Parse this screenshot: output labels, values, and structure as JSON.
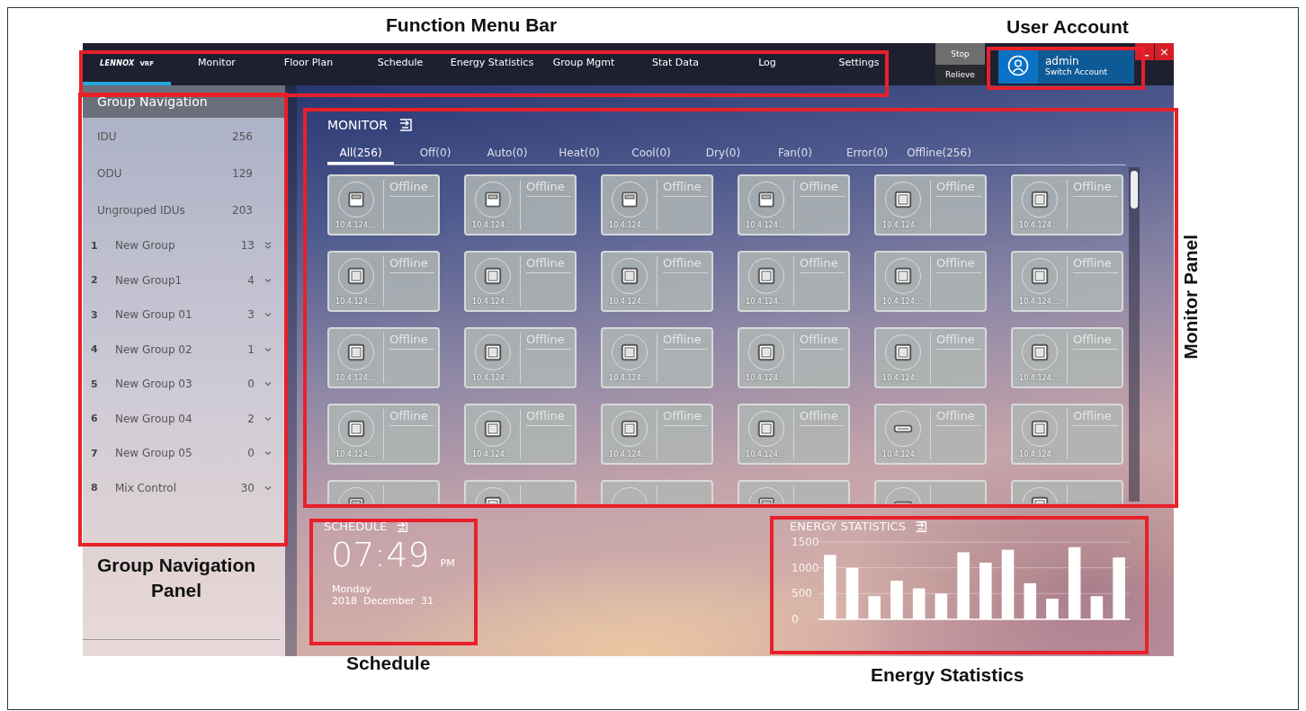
{
  "annotations": {
    "menu_bar": "Function Menu Bar",
    "user_account": "User Account",
    "monitor_panel": "Monitor Panel",
    "group_navigation": "Group Navigation Panel",
    "schedule": "Schedule",
    "energy_statistics": "Energy Statistics"
  },
  "top_bar": {
    "logo": {
      "brand": "LENNOX",
      "suffix": "VRF",
      "selected": true
    },
    "menu": [
      {
        "label": "Monitor",
        "selected": false
      },
      {
        "label": "Floor Plan",
        "selected": false
      },
      {
        "label": "Schedule",
        "selected": false
      },
      {
        "label": "Energy Statistics",
        "selected": false
      },
      {
        "label": "Group Mgmt",
        "selected": false
      },
      {
        "label": "Stat Data",
        "selected": false
      },
      {
        "label": "Log",
        "selected": false
      },
      {
        "label": "Settings",
        "selected": false
      }
    ],
    "actions": [
      {
        "label": "Stop",
        "selected": true
      },
      {
        "label": "Relieve",
        "selected": false
      }
    ],
    "account": {
      "name": "admin",
      "action": "Switch Account"
    },
    "window_controls": {
      "close": "×"
    }
  },
  "sidebar": {
    "title": "Group Navigation",
    "summary": [
      {
        "label": "IDU",
        "count": "256"
      },
      {
        "label": "ODU",
        "count": "129"
      },
      {
        "label": "Ungrouped IDUs",
        "count": "203"
      }
    ],
    "groups": [
      {
        "index": "1",
        "name": "New Group",
        "count": "13",
        "kind": "double"
      },
      {
        "index": "2",
        "name": "New Group1",
        "count": "4",
        "kind": "single"
      },
      {
        "index": "3",
        "name": "New Group 01",
        "count": "3",
        "kind": "single"
      },
      {
        "index": "4",
        "name": "New Group 02",
        "count": "1",
        "kind": "single"
      },
      {
        "index": "5",
        "name": "New Group 03",
        "count": "0",
        "kind": "single"
      },
      {
        "index": "6",
        "name": "New Group 04",
        "count": "2",
        "kind": "single"
      },
      {
        "index": "7",
        "name": "New Group 05",
        "count": "0",
        "kind": "single"
      },
      {
        "index": "8",
        "name": "Mix Control",
        "count": "30",
        "kind": "single"
      }
    ]
  },
  "monitor": {
    "title": "MONITOR",
    "tabs": [
      {
        "label": "All(256)",
        "selected": true
      },
      {
        "label": "Off(0)",
        "selected": false
      },
      {
        "label": "Auto(0)",
        "selected": false
      },
      {
        "label": "Heat(0)",
        "selected": false
      },
      {
        "label": "Cool(0)",
        "selected": false
      },
      {
        "label": "Dry(0)",
        "selected": false
      },
      {
        "label": "Fan(0)",
        "selected": false
      },
      {
        "label": "Error(0)",
        "selected": false
      },
      {
        "label": "Offline(256)",
        "selected": false
      }
    ],
    "devices": [
      {
        "kind": "panel",
        "status": "Offline",
        "ip": "10.4.124...."
      },
      {
        "kind": "panel",
        "status": "Offline",
        "ip": "10.4.124...."
      },
      {
        "kind": "panel",
        "status": "Offline",
        "ip": "10.4.124...."
      },
      {
        "kind": "panel",
        "status": "Offline",
        "ip": "10.4.124...."
      },
      {
        "kind": "cassette",
        "status": "Offline",
        "ip": "10.4.124...."
      },
      {
        "kind": "cassette",
        "status": "Offline",
        "ip": "10.4.124...."
      },
      {
        "kind": "cassette",
        "status": "Offline",
        "ip": "10.4.124...."
      },
      {
        "kind": "cassette",
        "status": "Offline",
        "ip": "10.4.124...."
      },
      {
        "kind": "cassette",
        "status": "Offline",
        "ip": "10.4.124...."
      },
      {
        "kind": "cassette",
        "status": "Offline",
        "ip": "10.4.124...."
      },
      {
        "kind": "cassette",
        "status": "Offline",
        "ip": "10.4.124...."
      },
      {
        "kind": "cassette",
        "status": "Offline",
        "ip": "10.4.124...."
      },
      {
        "kind": "cassette",
        "status": "Offline",
        "ip": "10.4.124...."
      },
      {
        "kind": "cassette",
        "status": "Offline",
        "ip": "10.4.124...."
      },
      {
        "kind": "cassette",
        "status": "Offline",
        "ip": "10.4.124...."
      },
      {
        "kind": "cassette",
        "status": "Offline",
        "ip": "10.4.124...."
      },
      {
        "kind": "cassette",
        "status": "Offline",
        "ip": "10.4.124...."
      },
      {
        "kind": "cassette",
        "status": "Offline",
        "ip": "10.4.124...."
      },
      {
        "kind": "cassette",
        "status": "Offline",
        "ip": "10.4.124...."
      },
      {
        "kind": "cassette",
        "status": "Offline",
        "ip": "10.4.124...."
      },
      {
        "kind": "cassette",
        "status": "Offline",
        "ip": "10.4.124...."
      },
      {
        "kind": "cassette",
        "status": "Offline",
        "ip": "10.4.124...."
      },
      {
        "kind": "wall",
        "status": "Offline",
        "ip": "10.4.124...."
      },
      {
        "kind": "cassette",
        "status": "Offline",
        "ip": "10.4.124...."
      },
      {
        "kind": "panel"
      },
      {
        "kind": "cassette"
      },
      {
        "kind": "blank"
      },
      {
        "kind": "panel"
      },
      {
        "kind": "wall"
      },
      {
        "kind": "cassette"
      }
    ]
  },
  "schedule": {
    "title": "SCHEDULE",
    "time": "07:49",
    "meridiem": "PM",
    "weekday": "Monday",
    "year": "2018",
    "month": "December",
    "day": "31"
  },
  "energy_statistics": {
    "title": "ENERGY STATISTICS",
    "chart_data": {
      "type": "bar",
      "values": [
        1250,
        1000,
        450,
        750,
        600,
        500,
        1300,
        1100,
        1350,
        700,
        400,
        1400,
        450,
        1200
      ],
      "ylim": [
        0,
        1500
      ],
      "yticks": [
        0,
        500,
        1000,
        1500
      ]
    }
  }
}
